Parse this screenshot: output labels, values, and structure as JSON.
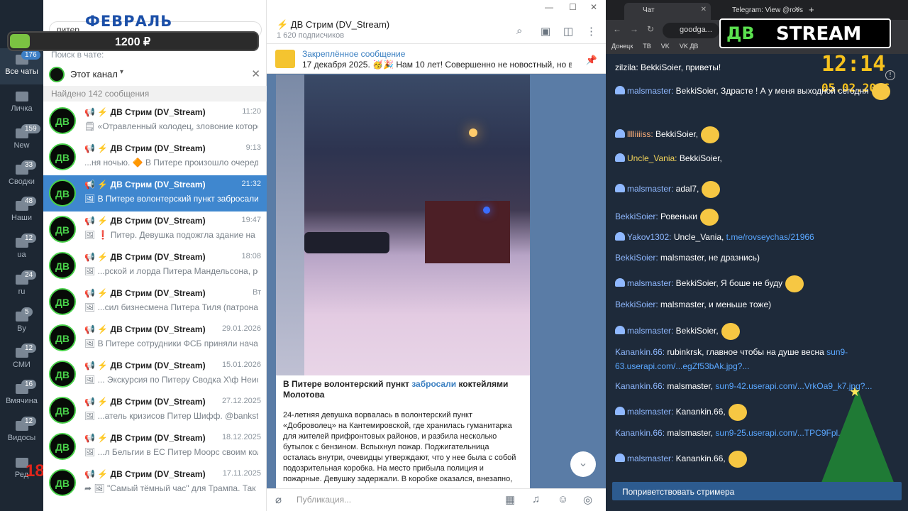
{
  "overlay": {
    "month": "ФЕВРАЛЬ",
    "amount": "1200 ₽",
    "progress_pct": 8
  },
  "sidebar": {
    "folders": [
      {
        "label": "Все чаты",
        "badge": "176",
        "active": true
      },
      {
        "label": "Личка",
        "badge": ""
      },
      {
        "label": "New",
        "badge": "159"
      },
      {
        "label": "Сводки",
        "badge": "33"
      },
      {
        "label": "Наши",
        "badge": "48"
      },
      {
        "label": "ua",
        "badge": "12"
      },
      {
        "label": "ru",
        "badge": "24"
      },
      {
        "label": "By",
        "badge": "5"
      },
      {
        "label": "СМИ",
        "badge": "12"
      },
      {
        "label": "Вмячина",
        "badge": "16"
      },
      {
        "label": "Видосы",
        "badge": "12"
      },
      {
        "label": "Ред",
        "badge": ""
      }
    ],
    "age_mark": "18+"
  },
  "search": {
    "value": "питер",
    "hint": "Поиск в чате:",
    "channel": "Этот канал",
    "found": "Найдено 142 сообщения"
  },
  "results": [
    {
      "avatar": "ДВ",
      "name": "📢 ⚡ ДВ Стрим (DV_Stream)",
      "time": "11:20",
      "preview": "🗒 «Отравленный колодец, зловоние которог..."
    },
    {
      "avatar": "ДВ",
      "name": "📢 ⚡ ДВ Стрим (DV_Stream)",
      "time": "9:13",
      "preview": "...ня ночью. 🔶 В Питере произошло очеред..."
    },
    {
      "avatar": "ДВ",
      "name": "📢 ⚡ ДВ Стрим (DV_Stream)",
      "time": "21:32",
      "preview": "🖼 В Питере волонтерский пункт забросали к...",
      "selected": true
    },
    {
      "avatar": "ДВ",
      "name": "📢 ⚡ ДВ Стрим (DV_Stream)",
      "time": "19:47",
      "preview": "🖼 ❗ Питер. Девушка подожгла здание на Ка..."
    },
    {
      "avatar": "ДВ",
      "name": "📢 ⚡ ДВ Стрим (DV_Stream)",
      "time": "18:08",
      "preview": "🖼 ...рской и лорда Питера Мандельсона, рег..."
    },
    {
      "avatar": "ДВ",
      "name": "📢 ⚡ ДВ Стрим (DV_Stream)",
      "time": "Вт",
      "preview": "🖼 ...сил бизнесмена Питера Тиля (патрона н..."
    },
    {
      "avatar": "ДВ",
      "name": "📢 ⚡ ДВ Стрим (DV_Stream)",
      "time": "29.01.2026",
      "preview": "🖼 В Питере сотрудники ФСБ приняли началь..."
    },
    {
      "avatar": "ДВ",
      "name": "📢 ⚡ ДВ Стрим (DV_Stream)",
      "time": "15.01.2026",
      "preview": "🖼 ... Экскурсия по Питеру Сводка Х\\ф Неисп..."
    },
    {
      "avatar": "ДВ",
      "name": "📢 ⚡ ДВ Стрим (DV_Stream)",
      "time": "27.12.2025",
      "preview": "🖼 ...атель кризисов Питер Шифф. @banksta"
    },
    {
      "avatar": "ДВ",
      "name": "📢 ⚡ ДВ Стрим (DV_Stream)",
      "time": "18.12.2025",
      "preview": "🖼 ...л Бельгии в ЕС Питер Моорс своим коллегам..."
    },
    {
      "avatar": "ДВ",
      "name": "📢 ⚡ ДВ Стрим (DV_Stream)",
      "time": "17.11.2025",
      "preview": "➦ 🖼 \"Самый тёмный час\" для Трампа. Так мо..."
    }
  ],
  "chat": {
    "title": "⚡ ДВ Стрим (DV_Stream)",
    "subtitle": "1 620 подписчиков",
    "pinned_label": "Закреплённое сообщение",
    "pinned_text": "17 декабря 2025. 🥳🎉 Нам 10 лет! Совершенно не новостный, но в ч...",
    "caption_title_a": "В Питере волонтерский пункт ",
    "caption_title_link": "забросали",
    "caption_title_b": " коктейлями Молотова",
    "caption_body": "24-летняя девушка ворвалась в волонтерский пункт «Доброволец» на Кантемировской, где хранилась гуманитарка для жителей прифронтовых районов, и разбила несколько бутылок с бензином. Вспыхнул пожар. Поджигательница осталась внутри, очевидцы утверждают, что у нее была с собой подозрительная коробка. На место прибыла полиция и пожарные. Девушку задержали. В коробке оказался, внезапно,",
    "input_placeholder": "Публикация..."
  },
  "browser": {
    "tab1": "Чат",
    "tab2": "Telegram: View @rovs",
    "url": "goodga...",
    "bookmarks": [
      "Донецк",
      "ТВ",
      "VK",
      "VK ДВ"
    ]
  },
  "stream": {
    "logo_a": "ДВ",
    "logo_b": "STREAM",
    "time": "12:14",
    "date": "05.02.2026",
    "messages": [
      {
        "user": "zilzila:",
        "text": " BekkiSoier, приветы!",
        "ucolor": "#ffffff"
      },
      {
        "user": "malsmaster:",
        "text": " BekkiSoier, Здрасте ! А у меня выходной сегодня",
        "ucolor": "#8fb8ff",
        "ghost": true
      },
      {
        "user": "lllliiiiss:",
        "text": " BekkiSoier,",
        "ucolor": "#ffb07a",
        "ghost": true
      },
      {
        "user": "Uncle_Vania:",
        "text": " BekkiSoier,",
        "ucolor": "#f2d35a",
        "ghost": true
      },
      {
        "user": "malsmaster:",
        "text": " adal7,",
        "ucolor": "#8fb8ff",
        "ghost": true
      },
      {
        "user": "BekkiSoier:",
        "text": " Ровеньки",
        "ucolor": "#8fb8ff"
      },
      {
        "user": "Yakov1302:",
        "text": " Uncle_Vania, ",
        "link": "t.me/rovseychas/21966",
        "ucolor": "#8fb8ff",
        "ghost": true
      },
      {
        "user": "BekkiSoier:",
        "text": " malsmaster, не дразнись)",
        "ucolor": "#8fb8ff"
      },
      {
        "user": "malsmaster:",
        "text": " BekkiSoier, Я боше не буду",
        "ucolor": "#8fb8ff",
        "ghost": true
      },
      {
        "user": "BekkiSoier:",
        "text": " malsmaster, и меньше тоже)",
        "ucolor": "#8fb8ff"
      },
      {
        "user": "malsmaster:",
        "text": " BekkiSoier,",
        "ucolor": "#8fb8ff",
        "ghost": true
      },
      {
        "user": "Kanankin.66:",
        "text": " rubinkrsk, главное чтобы на душе весна ",
        "link": "sun9-",
        "ucolor": "#8fb8ff"
      },
      {
        "user": "",
        "text": "",
        "link": "63.userapi.com/...egZf53bAk.jpg?...",
        "ucolor": "#8fb8ff"
      },
      {
        "user": "Kanankin.66:",
        "text": " malsmaster, ",
        "link": "sun9-42.userapi.com/...VrkOa9_k7.jpg?...",
        "ucolor": "#8fb8ff"
      },
      {
        "user": "malsmaster:",
        "text": " Kanankin.66,",
        "ucolor": "#8fb8ff",
        "ghost": true
      },
      {
        "user": "Kanankin.66:",
        "text": " malsmaster, ",
        "link": "sun9-25.userapi.com/...TPC9Fpl...",
        "ucolor": "#8fb8ff"
      },
      {
        "user": "malsmaster:",
        "text": " Kanankin.66,",
        "ucolor": "#8fb8ff",
        "ghost": true
      }
    ],
    "greet_button": "Поприветствовать стримера"
  }
}
